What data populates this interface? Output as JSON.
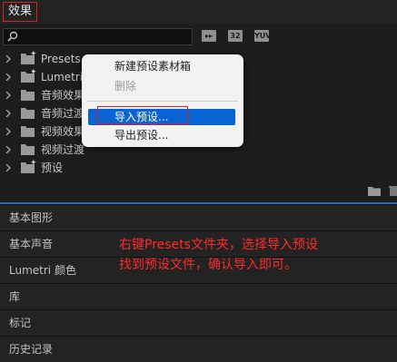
{
  "panel": {
    "title": "效果"
  },
  "search": {
    "placeholder": ""
  },
  "filters": {
    "accelerated": "▸▸",
    "bit32": "32",
    "yuv": "YUV"
  },
  "tree": [
    {
      "label": "Presets",
      "star": true
    },
    {
      "label": "Lumetri",
      "star": true
    },
    {
      "label": "音频效果",
      "star": false
    },
    {
      "label": "音频过渡",
      "star": false
    },
    {
      "label": "视频效果",
      "star": false
    },
    {
      "label": "视频过渡",
      "star": false
    },
    {
      "label": "预设",
      "star": true
    }
  ],
  "panels": [
    "基本图形",
    "基本声音",
    "Lumetri 颜色",
    "库",
    "标记",
    "历史记录"
  ],
  "context_menu": {
    "new_bin": "新建预设素材箱",
    "delete": "删除",
    "import": "导入预设...",
    "export": "导出预设..."
  },
  "annotation": {
    "line1": "右键Presets文件夹，选择导入预设",
    "line2": "找到预设文件，确认导入即可。"
  },
  "colors": {
    "accent": "#0a63d3",
    "highlight_border": "#e02020",
    "annotation": "#ff2a2a"
  }
}
